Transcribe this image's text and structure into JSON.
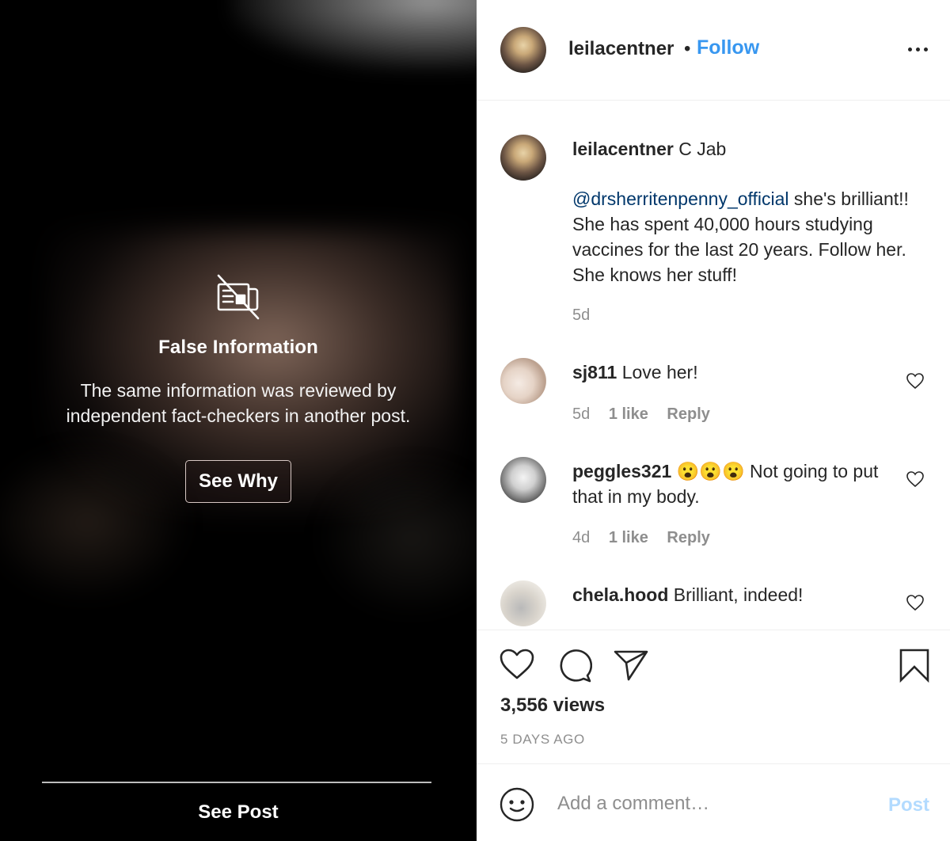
{
  "media": {
    "warning_icon": "false-info-newspaper-slash-icon",
    "warning_title": "False Information",
    "warning_desc": "The same information was reviewed by independent fact-checkers in another post.",
    "see_why_label": "See Why",
    "see_post_label": "See Post"
  },
  "header": {
    "username": "leilacentner",
    "separator": "•",
    "follow_label": "Follow",
    "more_icon": "more-options-icon"
  },
  "caption": {
    "username": "leilacentner",
    "title_text": "C Jab",
    "mention": "@drsherritenpenny_official",
    "body": " she's brilliant!! She has spent 40,000 hours studying vaccines for the last 20 years. Follow her. She knows her stuff!",
    "time": "5d"
  },
  "comments": [
    {
      "username": "sj811",
      "text": "Love her!",
      "time": "5d",
      "likes": "1 like",
      "reply_label": "Reply"
    },
    {
      "username": "peggles321",
      "text": "😮😮😮 Not going to put that in my body.",
      "time": "4d",
      "likes": "1 like",
      "reply_label": "Reply"
    },
    {
      "username": "chela.hood",
      "text": "Brilliant, indeed!"
    }
  ],
  "actions": {
    "like_icon": "heart-icon",
    "comment_icon": "comment-icon",
    "share_icon": "share-icon",
    "save_icon": "bookmark-icon"
  },
  "stats": {
    "views": "3,556 views",
    "posted": "5 DAYS AGO"
  },
  "comment_box": {
    "placeholder": "Add a comment…",
    "value": "",
    "post_label": "Post"
  },
  "colors": {
    "accent": "#3897f0",
    "mention": "#00376b",
    "post_disabled": "#b3dbff",
    "muted": "#8e8e8e"
  }
}
